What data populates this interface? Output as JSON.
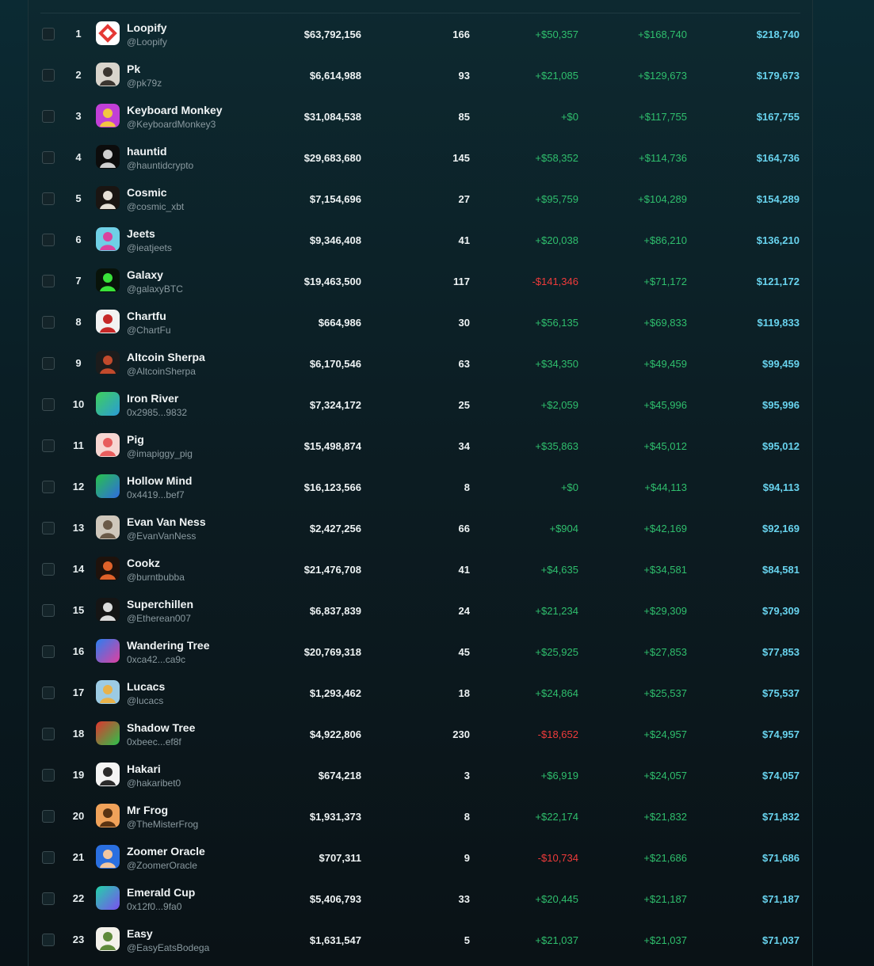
{
  "colors": {
    "positive": "#2fbf6d",
    "negative": "#ef3b3b",
    "total": "#68d3ee"
  },
  "rows": [
    {
      "rank": "1",
      "name": "Loopify",
      "handle": "@Loopify",
      "volume": "$63,792,156",
      "trades": "166",
      "pnl_a": "+$50,357",
      "pnl_b": "+$168,740",
      "total": "$218,740",
      "avatar": {
        "type": "logo",
        "bg": "#ffffff",
        "fg": "#e53935"
      }
    },
    {
      "rank": "2",
      "name": "Pk",
      "handle": "@pk79z",
      "volume": "$6,614,988",
      "trades": "93",
      "pnl_a": "+$21,085",
      "pnl_b": "+$129,673",
      "total": "$179,673",
      "avatar": {
        "type": "photo",
        "bg": "#d8d4cc",
        "fg": "#3a3530"
      }
    },
    {
      "rank": "3",
      "name": "Keyboard Monkey",
      "handle": "@KeyboardMonkey3",
      "volume": "$31,084,538",
      "trades": "85",
      "pnl_a": "+$0",
      "pnl_b": "+$117,755",
      "total": "$167,755",
      "avatar": {
        "type": "photo",
        "bg": "#c13fd6",
        "fg": "#f2c542"
      }
    },
    {
      "rank": "4",
      "name": "hauntid",
      "handle": "@hauntidcrypto",
      "volume": "$29,683,680",
      "trades": "145",
      "pnl_a": "+$58,352",
      "pnl_b": "+$114,736",
      "total": "$164,736",
      "avatar": {
        "type": "photo",
        "bg": "#0c0c0c",
        "fg": "#cfcfcf"
      }
    },
    {
      "rank": "5",
      "name": "Cosmic",
      "handle": "@cosmic_xbt",
      "volume": "$7,154,696",
      "trades": "27",
      "pnl_a": "+$95,759",
      "pnl_b": "+$104,289",
      "total": "$154,289",
      "avatar": {
        "type": "photo",
        "bg": "#1a1512",
        "fg": "#e6e0d6"
      }
    },
    {
      "rank": "6",
      "name": "Jeets",
      "handle": "@ieatjeets",
      "volume": "$9,346,408",
      "trades": "41",
      "pnl_a": "+$20,038",
      "pnl_b": "+$86,210",
      "total": "$136,210",
      "avatar": {
        "type": "photo",
        "bg": "#6fd0e6",
        "fg": "#d9449e"
      }
    },
    {
      "rank": "7",
      "name": "Galaxy",
      "handle": "@galaxyBTC",
      "volume": "$19,463,500",
      "trades": "117",
      "pnl_a": "-$141,346",
      "pnl_b": "+$71,172",
      "total": "$121,172",
      "avatar": {
        "type": "photo",
        "bg": "#08130a",
        "fg": "#39e23a"
      }
    },
    {
      "rank": "8",
      "name": "Chartfu",
      "handle": "@ChartFu",
      "volume": "$664,986",
      "trades": "30",
      "pnl_a": "+$56,135",
      "pnl_b": "+$69,833",
      "total": "$119,833",
      "avatar": {
        "type": "photo",
        "bg": "#f2f2f2",
        "fg": "#c62828"
      }
    },
    {
      "rank": "9",
      "name": "Altcoin Sherpa",
      "handle": "@AltcoinSherpa",
      "volume": "$6,170,546",
      "trades": "63",
      "pnl_a": "+$34,350",
      "pnl_b": "+$49,459",
      "total": "$99,459",
      "avatar": {
        "type": "photo",
        "bg": "#1c1c1c",
        "fg": "#c24a2c"
      }
    },
    {
      "rank": "10",
      "name": "Iron River",
      "handle": "0x2985...9832",
      "volume": "$7,324,172",
      "trades": "25",
      "pnl_a": "+$2,059",
      "pnl_b": "+$45,996",
      "total": "$95,996",
      "avatar": {
        "type": "gradient",
        "c1": "#3fd05a",
        "c2": "#2a9bd8"
      }
    },
    {
      "rank": "11",
      "name": "Pig",
      "handle": "@imapiggy_pig",
      "volume": "$15,498,874",
      "trades": "34",
      "pnl_a": "+$35,863",
      "pnl_b": "+$45,012",
      "total": "$95,012",
      "avatar": {
        "type": "photo",
        "bg": "#f7d6d2",
        "fg": "#e85d5d"
      }
    },
    {
      "rank": "12",
      "name": "Hollow Mind",
      "handle": "0x4419...bef7",
      "volume": "$16,123,566",
      "trades": "8",
      "pnl_a": "+$0",
      "pnl_b": "+$44,113",
      "total": "$94,113",
      "avatar": {
        "type": "gradient",
        "c1": "#27c24a",
        "c2": "#2f6be0"
      }
    },
    {
      "rank": "13",
      "name": "Evan Van Ness",
      "handle": "@EvanVanNess",
      "volume": "$2,427,256",
      "trades": "66",
      "pnl_a": "+$904",
      "pnl_b": "+$42,169",
      "total": "$92,169",
      "avatar": {
        "type": "photo",
        "bg": "#cfc7bb",
        "fg": "#6b5a48"
      }
    },
    {
      "rank": "14",
      "name": "Cookz",
      "handle": "@burntbubba",
      "volume": "$21,476,708",
      "trades": "41",
      "pnl_a": "+$4,635",
      "pnl_b": "+$34,581",
      "total": "$84,581",
      "avatar": {
        "type": "photo",
        "bg": "#1e120c",
        "fg": "#e0622a"
      }
    },
    {
      "rank": "15",
      "name": "Superchillen",
      "handle": "@Etherean007",
      "volume": "$6,837,839",
      "trades": "24",
      "pnl_a": "+$21,234",
      "pnl_b": "+$29,309",
      "total": "$79,309",
      "avatar": {
        "type": "photo",
        "bg": "#151515",
        "fg": "#dcdcdc"
      }
    },
    {
      "rank": "16",
      "name": "Wandering Tree",
      "handle": "0xca42...ca9c",
      "volume": "$20,769,318",
      "trades": "45",
      "pnl_a": "+$25,925",
      "pnl_b": "+$27,853",
      "total": "$77,853",
      "avatar": {
        "type": "gradient",
        "c1": "#2a7ff0",
        "c2": "#e03fa0"
      }
    },
    {
      "rank": "17",
      "name": "Lucacs",
      "handle": "@lucacs",
      "volume": "$1,293,462",
      "trades": "18",
      "pnl_a": "+$24,864",
      "pnl_b": "+$25,537",
      "total": "$75,537",
      "avatar": {
        "type": "photo",
        "bg": "#9ccbe3",
        "fg": "#e8b24a"
      }
    },
    {
      "rank": "18",
      "name": "Shadow Tree",
      "handle": "0xbeec...ef8f",
      "volume": "$4,922,806",
      "trades": "230",
      "pnl_a": "-$18,652",
      "pnl_b": "+$24,957",
      "total": "$74,957",
      "avatar": {
        "type": "gradient",
        "c1": "#e0352f",
        "c2": "#2cc24a"
      }
    },
    {
      "rank": "19",
      "name": "Hakari",
      "handle": "@hakaribet0",
      "volume": "$674,218",
      "trades": "3",
      "pnl_a": "+$6,919",
      "pnl_b": "+$24,057",
      "total": "$74,057",
      "avatar": {
        "type": "photo",
        "bg": "#f4f4f4",
        "fg": "#2a2a2a"
      }
    },
    {
      "rank": "20",
      "name": "Mr Frog",
      "handle": "@TheMisterFrog",
      "volume": "$1,931,373",
      "trades": "8",
      "pnl_a": "+$22,174",
      "pnl_b": "+$21,832",
      "total": "$71,832",
      "avatar": {
        "type": "photo",
        "bg": "#f0a25a",
        "fg": "#5a3312"
      }
    },
    {
      "rank": "21",
      "name": "Zoomer Oracle",
      "handle": "@ZoomerOracle",
      "volume": "$707,311",
      "trades": "9",
      "pnl_a": "-$10,734",
      "pnl_b": "+$21,686",
      "total": "$71,686",
      "avatar": {
        "type": "photo",
        "bg": "#2a6fe0",
        "fg": "#f2c6a0"
      }
    },
    {
      "rank": "22",
      "name": "Emerald Cup",
      "handle": "0x12f0...9fa0",
      "volume": "$5,406,793",
      "trades": "33",
      "pnl_a": "+$20,445",
      "pnl_b": "+$21,187",
      "total": "$71,187",
      "avatar": {
        "type": "gradient",
        "c1": "#22d3a8",
        "c2": "#7b4ff0"
      }
    },
    {
      "rank": "23",
      "name": "Easy",
      "handle": "@EasyEatsBodega",
      "volume": "$1,631,547",
      "trades": "5",
      "pnl_a": "+$21,037",
      "pnl_b": "+$21,037",
      "total": "$71,037",
      "avatar": {
        "type": "photo",
        "bg": "#f3f1ea",
        "fg": "#5f8a3a"
      }
    }
  ]
}
